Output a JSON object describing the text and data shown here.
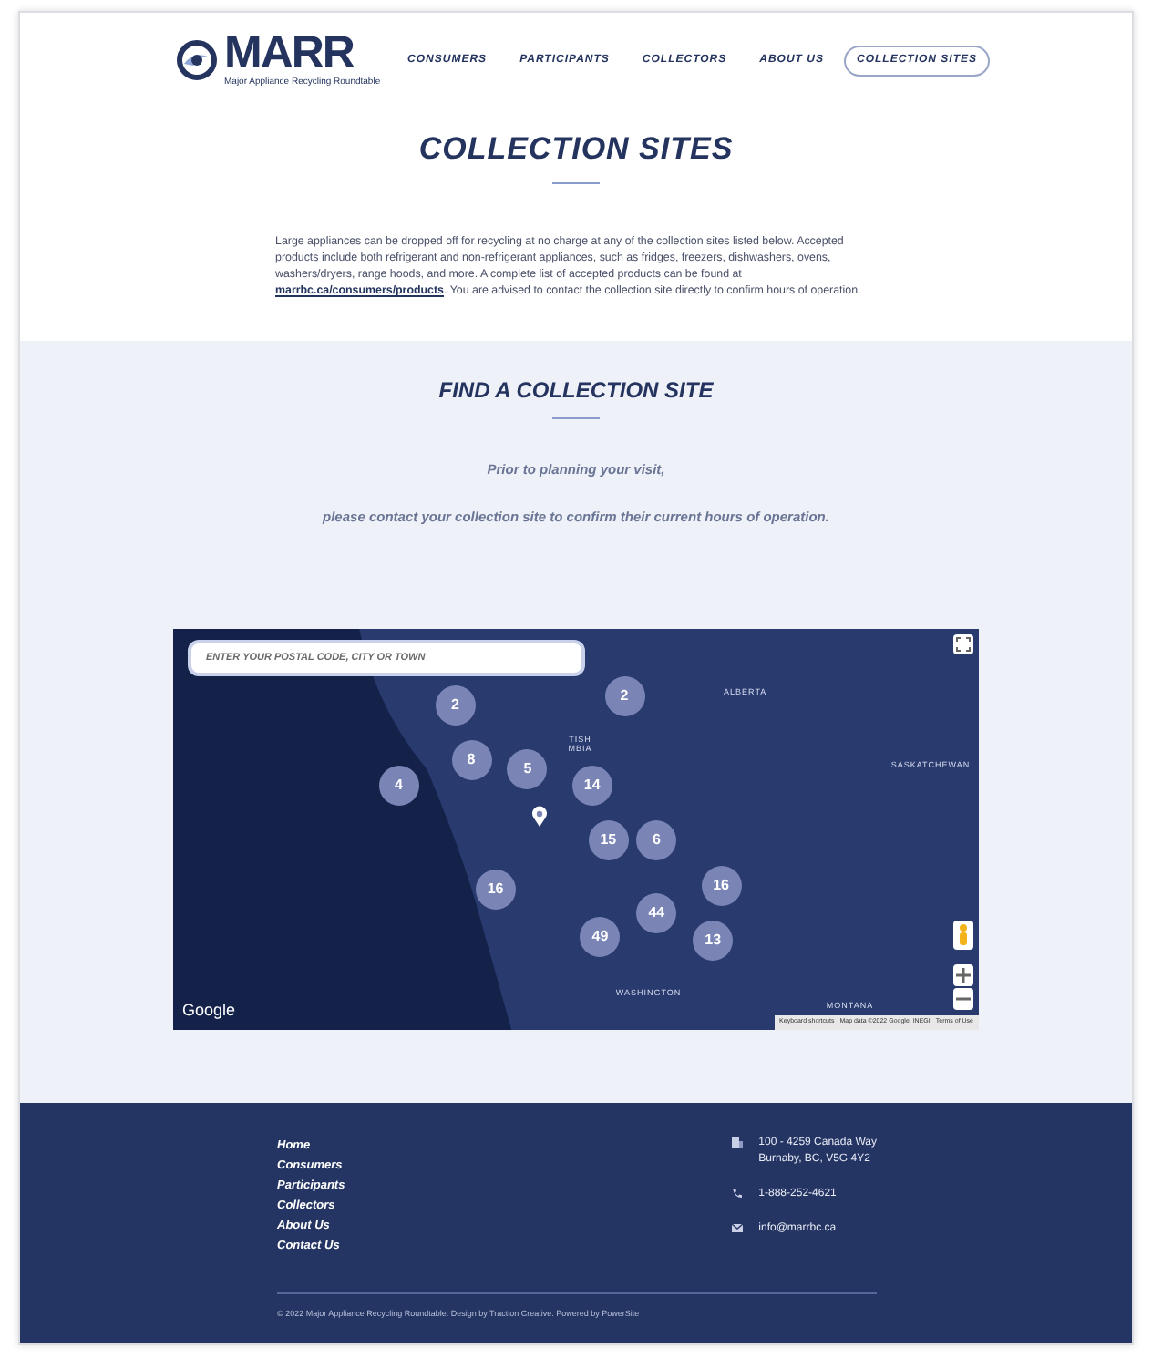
{
  "header": {
    "logo": {
      "name": "MARR",
      "tagline": "Major Appliance Recycling Roundtable"
    },
    "nav": [
      {
        "label": "CONSUMERS",
        "selected": false
      },
      {
        "label": "PARTICIPANTS",
        "selected": false
      },
      {
        "label": "COLLECTORS",
        "selected": false
      },
      {
        "label": "ABOUT US",
        "selected": false
      },
      {
        "label": "COLLECTION SITES",
        "selected": true
      }
    ]
  },
  "intro": {
    "title": "COLLECTION SITES",
    "text": "Large appliances can be dropped off for recycling at no charge at any of the collection sites listed below. Accepted products include both refrigerant and non-refrigerant appliances, such as fridges, freezers, dishwashers, ovens, washers/dryers, range hoods, and more. A complete list of accepted products can be found at",
    "link": "marrbc.ca/consumers/products",
    "text_after": ". You are advised to contact the collection site directly to confirm hours of operation."
  },
  "finder": {
    "title": "FIND A COLLECTION SITE",
    "notice": [
      "Prior to planning your visit,",
      "please contact your collection site to confirm their current hours of operation."
    ],
    "map": {
      "search": {
        "placeholder": "ENTER YOUR POSTAL CODE, CITY OR TOWN"
      },
      "labels": [
        "ALBERTA",
        "SASKATCHEWAN",
        "TISH MBIA",
        "WASHINGTON",
        "MONTANA"
      ],
      "clusters": [
        "2",
        "2",
        "8",
        "5",
        "4",
        "14",
        "15",
        "6",
        "16",
        "16",
        "44",
        "49",
        "13"
      ],
      "brand": "Google",
      "attribution": [
        "Keyboard shortcuts",
        "Map data ©2022 Google, INEGI",
        "Terms of Use"
      ]
    }
  },
  "footer": {
    "links": [
      "Home",
      "Consumers",
      "Participants",
      "Collectors",
      "About Us",
      "Contact Us"
    ],
    "contacts": [
      {
        "kind": "address",
        "lines": [
          "100 - 4259 Canada Way",
          "Burnaby, BC, V5G 4Y2"
        ]
      },
      {
        "kind": "phone",
        "lines": [
          "1-888-252-4621"
        ]
      },
      {
        "kind": "email",
        "lines": [
          "info@marrbc.ca"
        ]
      }
    ],
    "copyright": "© 2022 Major Appliance Recycling Roundtable. Design by Traction Creative. Powered by PowerSite"
  }
}
